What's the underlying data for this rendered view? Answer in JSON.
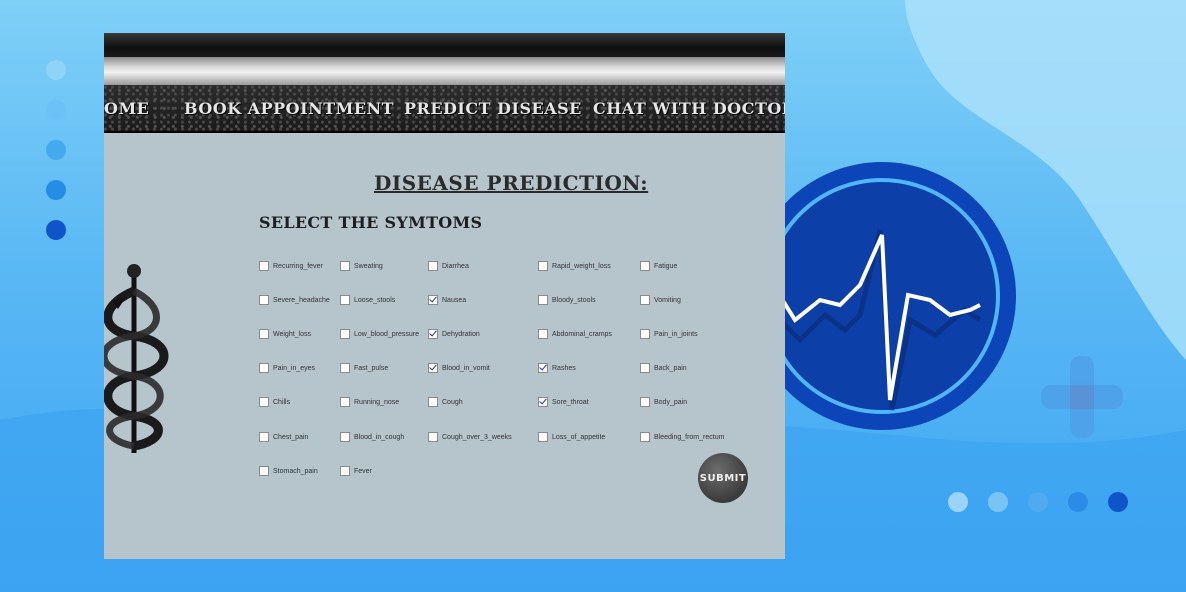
{
  "colors": {
    "background_light": "#7fd0f7",
    "background_dark": "#3ea6f3",
    "accent_blue": "#0b4fc2",
    "form_bg": "#b6c4cc"
  },
  "nav": {
    "items": [
      {
        "label": "OME"
      },
      {
        "label": "BOOK APPOINTMENT"
      },
      {
        "label": "PREDICT DISEASE"
      },
      {
        "label": "CHAT WITH DOCTORS"
      }
    ]
  },
  "form": {
    "title": "DISEASE PREDICTION:",
    "subtitle": "SELECT THE SYMTOMS",
    "submit_label": "SUBMIT",
    "symptoms": [
      {
        "label": "Recurring_fever",
        "checked": false
      },
      {
        "label": "Sweating",
        "checked": false
      },
      {
        "label": "Diarrhea",
        "checked": false
      },
      {
        "label": "Rapid_weight_loss",
        "checked": false
      },
      {
        "label": "Fatigue",
        "checked": false
      },
      {
        "label": "Severe_headache",
        "checked": false
      },
      {
        "label": "Loose_stools",
        "checked": false
      },
      {
        "label": "Nausea",
        "checked": true
      },
      {
        "label": "Bloody_stools",
        "checked": false
      },
      {
        "label": "Vomiting",
        "checked": false
      },
      {
        "label": "Weight_loss",
        "checked": false
      },
      {
        "label": "Low_blood_pressure",
        "checked": false
      },
      {
        "label": "Dehydration",
        "checked": true
      },
      {
        "label": "Abdominal_cramps",
        "checked": false
      },
      {
        "label": "Pain_in_joints",
        "checked": false
      },
      {
        "label": "Pain_in_eyes",
        "checked": false
      },
      {
        "label": "Fast_pulse",
        "checked": false
      },
      {
        "label": "Blood_in_vomit",
        "checked": true
      },
      {
        "label": "Rashes",
        "checked": true
      },
      {
        "label": "Back_pain",
        "checked": false
      },
      {
        "label": "Chills",
        "checked": false
      },
      {
        "label": "Running_nose",
        "checked": false
      },
      {
        "label": "Cough",
        "checked": false
      },
      {
        "label": "Sore_throat",
        "checked": true
      },
      {
        "label": "Body_pain",
        "checked": false
      },
      {
        "label": "Chest_pain",
        "checked": false
      },
      {
        "label": "Blood_in_cough",
        "checked": false
      },
      {
        "label": "Cough_over_3_weeks",
        "checked": false
      },
      {
        "label": "Loss_of_appetite",
        "checked": false
      },
      {
        "label": "Bleeding_from_rectum",
        "checked": false
      },
      {
        "label": "Stomach_pain",
        "checked": false
      },
      {
        "label": "Fever",
        "checked": false
      }
    ]
  },
  "decor": {
    "left_dots_icon": "dot-column-icon",
    "bottom_dots_icon": "dot-row-icon",
    "heartbeat_icon": "heartbeat-icon",
    "plus_icon": "plus-icon",
    "caduceus_icon": "caduceus-icon"
  }
}
